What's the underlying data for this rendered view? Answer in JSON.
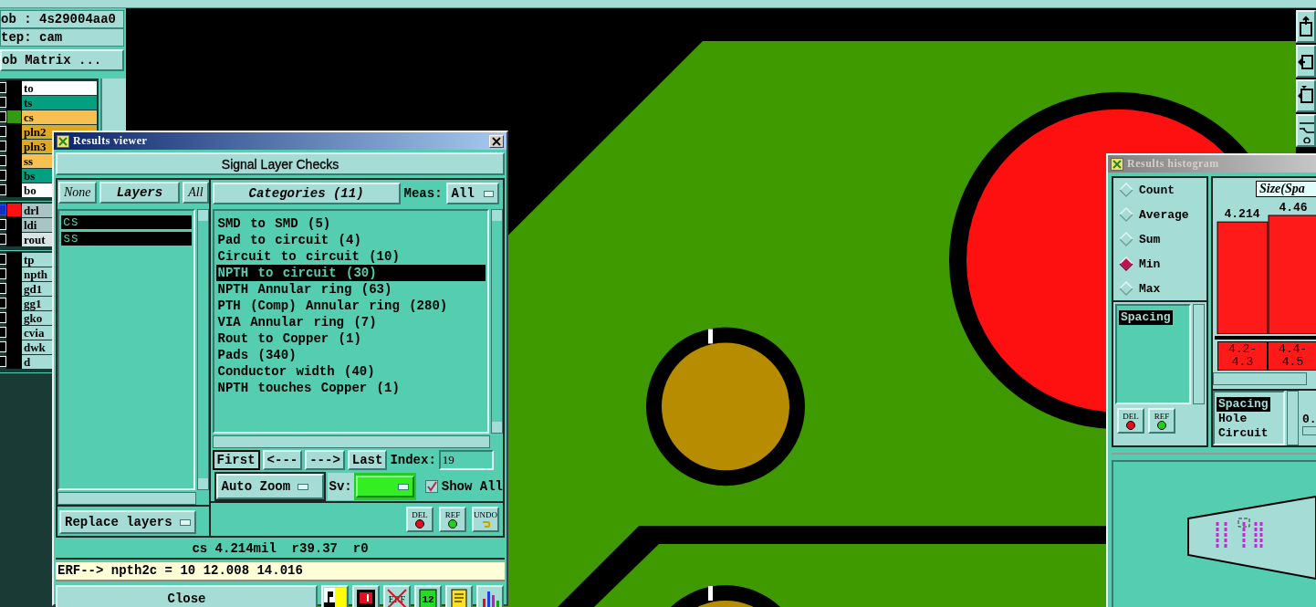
{
  "job_panel": {
    "job": "ob : 4s29004aa0",
    "step": "tep: cam",
    "matrix_button": "ob Matrix ...",
    "layer_groups": [
      {
        "layers": [
          {
            "name": "to",
            "color": "#ffffff",
            "selected": false
          },
          {
            "name": "ts",
            "color": "#00a080",
            "selected": false
          },
          {
            "name": "cs",
            "color": "#f8c050",
            "selected": false,
            "swatch": {
              "color": "#339911"
            }
          },
          {
            "name": "pln2",
            "color": "#e0a820",
            "selected": false
          },
          {
            "name": "pln3",
            "color": "#e0a820",
            "selected": false
          },
          {
            "name": "ss",
            "color": "#f8c050",
            "selected": false
          },
          {
            "name": "bs",
            "color": "#00a080",
            "selected": false
          },
          {
            "name": "bo",
            "color": "#ffffff",
            "selected": false
          }
        ]
      },
      {
        "layers": [
          {
            "name": "drl",
            "color": "#a8c4c4",
            "selected": true,
            "swatch": {
              "color": "#ff1111"
            }
          },
          {
            "name": "ldi",
            "color": "#a8c4c4",
            "selected": false
          },
          {
            "name": "rout",
            "color": "#d8e4e4",
            "selected": false
          }
        ]
      },
      {
        "layers": [
          {
            "name": "tp",
            "color": "#a6dcd6",
            "selected": false
          },
          {
            "name": "npth",
            "color": "#a6dcd6",
            "selected": false
          },
          {
            "name": "gd1",
            "color": "#a6dcd6",
            "selected": false
          },
          {
            "name": "gg1",
            "color": "#a6dcd6",
            "selected": false
          },
          {
            "name": "gko",
            "color": "#a6dcd6",
            "selected": false
          },
          {
            "name": "cvia",
            "color": "#a6dcd6",
            "selected": false
          },
          {
            "name": "dwk",
            "color": "#a6dcd6",
            "selected": false
          },
          {
            "name": "d",
            "color": "#a6dcd6",
            "selected": false
          }
        ]
      }
    ]
  },
  "results_viewer": {
    "title": "Results viewer",
    "header": "Signal Layer Checks",
    "layers_none": "None",
    "layers_title": "Layers",
    "layers_all": "All",
    "layers": [
      {
        "name": "cs",
        "selected": true
      },
      {
        "name": "ss",
        "selected": true
      }
    ],
    "categories_title": "Categories (11)",
    "meas_label": "Meas:",
    "meas_value": "All",
    "categories": [
      {
        "label": "SMD to SMD (5)",
        "selected": false
      },
      {
        "label": "Pad to circuit (4)",
        "selected": false
      },
      {
        "label": "Circuit to circuit (10)",
        "selected": false
      },
      {
        "label": "NPTH to circuit (30)",
        "selected": true
      },
      {
        "label": "NPTH Annular ring (63)",
        "selected": false
      },
      {
        "label": "PTH (Comp) Annular ring (280)",
        "selected": false
      },
      {
        "label": "VIA Annular ring (7)",
        "selected": false
      },
      {
        "label": "Rout to Copper (1)",
        "selected": false
      },
      {
        "label": "Pads (340)",
        "selected": false
      },
      {
        "label": "Conductor width (40)",
        "selected": false
      },
      {
        "label": "NPTH touches Copper (1)",
        "selected": false
      }
    ],
    "nav": [
      "First",
      "<---",
      "--->",
      "Last"
    ],
    "index_label": "Index:",
    "index_value": "19",
    "zoom_mode": "Auto Zoom",
    "sv_label": "Sv:",
    "show_all": {
      "label": "Show All",
      "checked": true
    },
    "replace_mode": "Replace layers",
    "tools": [
      {
        "kind": "del",
        "label": "DEL"
      },
      {
        "kind": "ref",
        "label": "REF"
      },
      {
        "kind": "undo",
        "label": "UNDO"
      }
    ],
    "status": "cs 4.214mil  r39.37  r0",
    "erf_line": "ERF--> npth2c = 10 12.008 14.016",
    "close": "Close",
    "bottom_tools": [
      {
        "kind": "profile"
      },
      {
        "kind": "marker"
      },
      {
        "kind": "erf-off",
        "label": "ERF"
      },
      {
        "kind": "numbers",
        "label": "12"
      },
      {
        "kind": "notes"
      },
      {
        "kind": "chart"
      }
    ]
  },
  "results_histogram": {
    "title": "Results histogram",
    "modes": [
      {
        "label": "Count",
        "selected": false
      },
      {
        "label": "Average",
        "selected": false
      },
      {
        "label": "Sum",
        "selected": false
      },
      {
        "label": "Min",
        "selected": true
      },
      {
        "label": "Max",
        "selected": false
      }
    ],
    "measures": [
      {
        "label": "Spacing",
        "selected": true
      }
    ],
    "tools": [
      {
        "kind": "del",
        "label": "DEL"
      },
      {
        "kind": "ref",
        "label": "REF"
      }
    ],
    "chart_data": {
      "type": "bar",
      "title": "Size(Spa",
      "categories": [
        "4.2-4.3",
        "4.4-4.5"
      ],
      "values": [
        4.214,
        4.46
      ],
      "data_labels": true
    },
    "groups": [
      {
        "label": "Spacing",
        "selected": true
      },
      {
        "label": "Hole",
        "selected": false
      },
      {
        "label": "Circuit",
        "selected": false
      }
    ],
    "slider_value": "0."
  }
}
